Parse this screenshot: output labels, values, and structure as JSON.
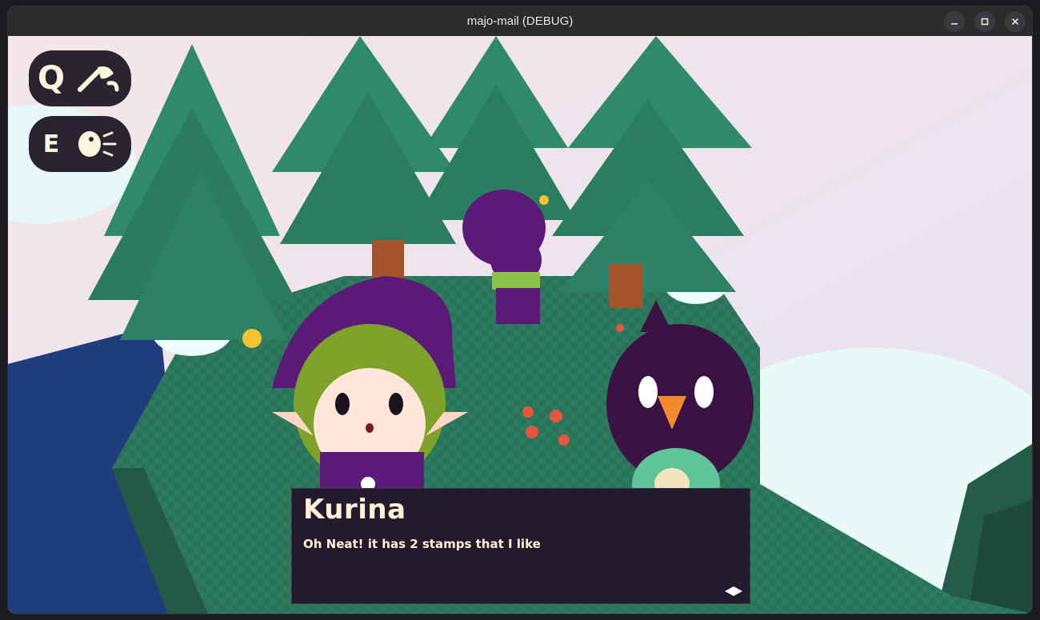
{
  "window": {
    "title": "majo-mail (DEBUG)",
    "controls": [
      "minimize-icon",
      "maximize-icon",
      "close-icon"
    ]
  },
  "hud": {
    "action_q": {
      "key": "Q",
      "icon": "broom-icon"
    },
    "action_e": {
      "key": "E",
      "icon": "talk-icon"
    }
  },
  "dialog": {
    "speaker": "Kurina",
    "text": "Oh Neat! it has 2 stamps that I like",
    "advance_icon": "advance-diamond-icon"
  },
  "colors": {
    "sky": "#f2e3ec",
    "grass": "#2f7e62",
    "tree": "#2d7b64",
    "water": "#1f3c7d",
    "dialog_bg": "#231b2d",
    "dialog_text": "#fff1d6"
  }
}
